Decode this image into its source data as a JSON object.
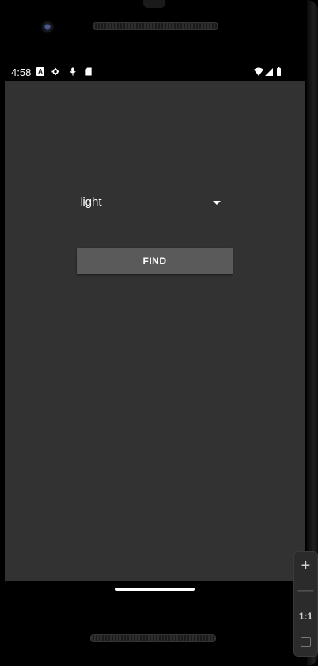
{
  "status_bar": {
    "time": "4:58",
    "left_icons": [
      "a-badge-icon",
      "gear-icon",
      "mic-icon",
      "sd-card-icon"
    ],
    "a_badge_text": "A",
    "right_icons": [
      "wifi-icon",
      "signal-icon",
      "battery-icon"
    ]
  },
  "app": {
    "spinner": {
      "selected_value": "light"
    },
    "find_button_label": "FIND"
  },
  "emulator_toolbar": {
    "zoom_in_label": "+",
    "zoom_out_label": "—",
    "one_to_one_label": "1:1"
  },
  "colors": {
    "screen_bg": "#323232",
    "button_bg": "#5a5a5a",
    "text": "#ffffff"
  }
}
